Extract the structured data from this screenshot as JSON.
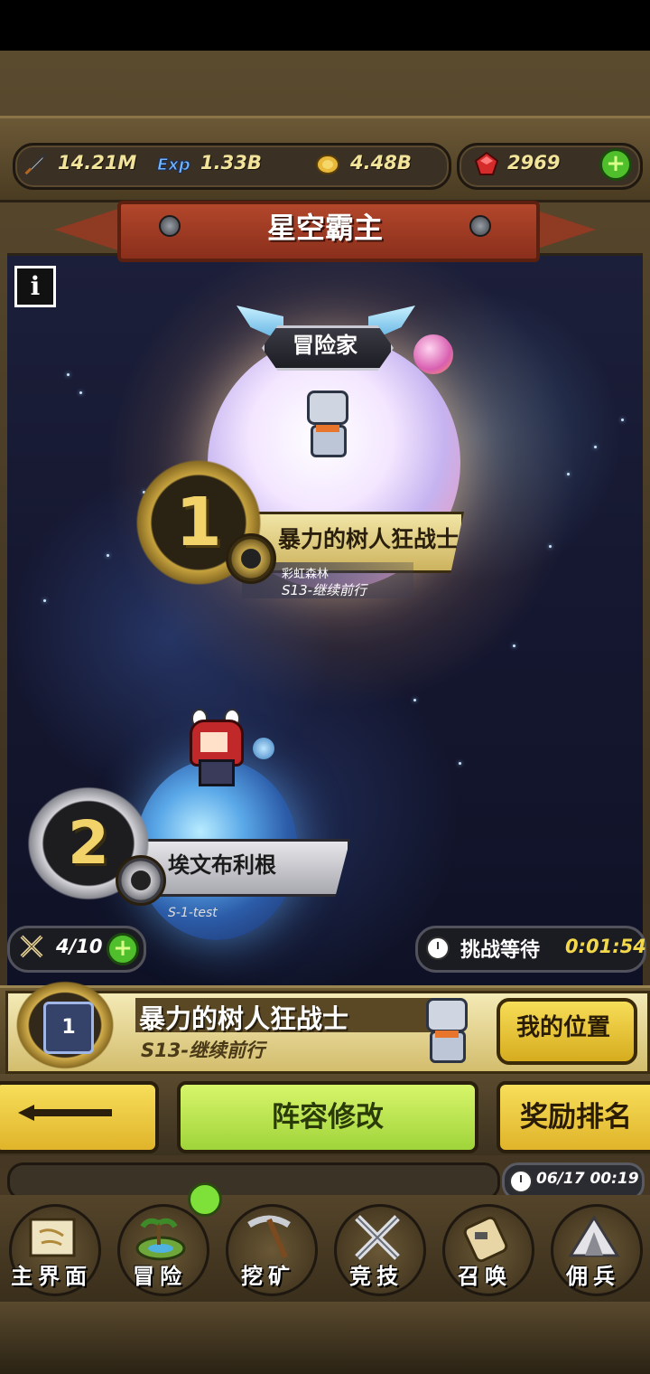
{
  "resources": {
    "attack": {
      "icon": "sword-icon",
      "value": "14.21M"
    },
    "exp": {
      "icon": "exp-icon",
      "value": "1.33B"
    },
    "gold": {
      "icon": "coin-icon",
      "value": "4.48B"
    },
    "gems": {
      "icon": "ruby-icon",
      "value": "2969"
    }
  },
  "banner": {
    "title": "星空霸主"
  },
  "info_label": "i",
  "rank1": {
    "rank": "1",
    "title": "冒险家",
    "name": "暴力的树人狂战士",
    "guild": "彩虹森林",
    "server": "S13-继续前行"
  },
  "rank2": {
    "rank": "2",
    "name": "埃文布利根",
    "server": "S-1-test"
  },
  "challenge": {
    "tickets": "4/10",
    "wait_label": "挑战等待",
    "wait_time": "0:01:54"
  },
  "my_rank": {
    "emblem": "1",
    "name": "暴力的树人狂战士",
    "server": "S13-继续前行",
    "my_position_label": "我的位置"
  },
  "actions": {
    "formation_label": "阵容修改",
    "reward_label": "奖励排名"
  },
  "status": {
    "datetime": "06/17 00:19"
  },
  "nav": [
    {
      "label": "主界面",
      "icon": "scroll-map-icon"
    },
    {
      "label": "冒险",
      "icon": "island-icon"
    },
    {
      "label": "挖矿",
      "icon": "pickaxe-icon"
    },
    {
      "label": "竞技",
      "icon": "crossed-swords-icon"
    },
    {
      "label": "召唤",
      "icon": "summon-scroll-icon"
    },
    {
      "label": "佣兵",
      "icon": "tent-icon"
    }
  ],
  "colors": {
    "accent_gold": "#f1d36a",
    "action_green": "#9fd43a",
    "action_yellow": "#e0b42a",
    "banner_red": "#b2472b"
  }
}
